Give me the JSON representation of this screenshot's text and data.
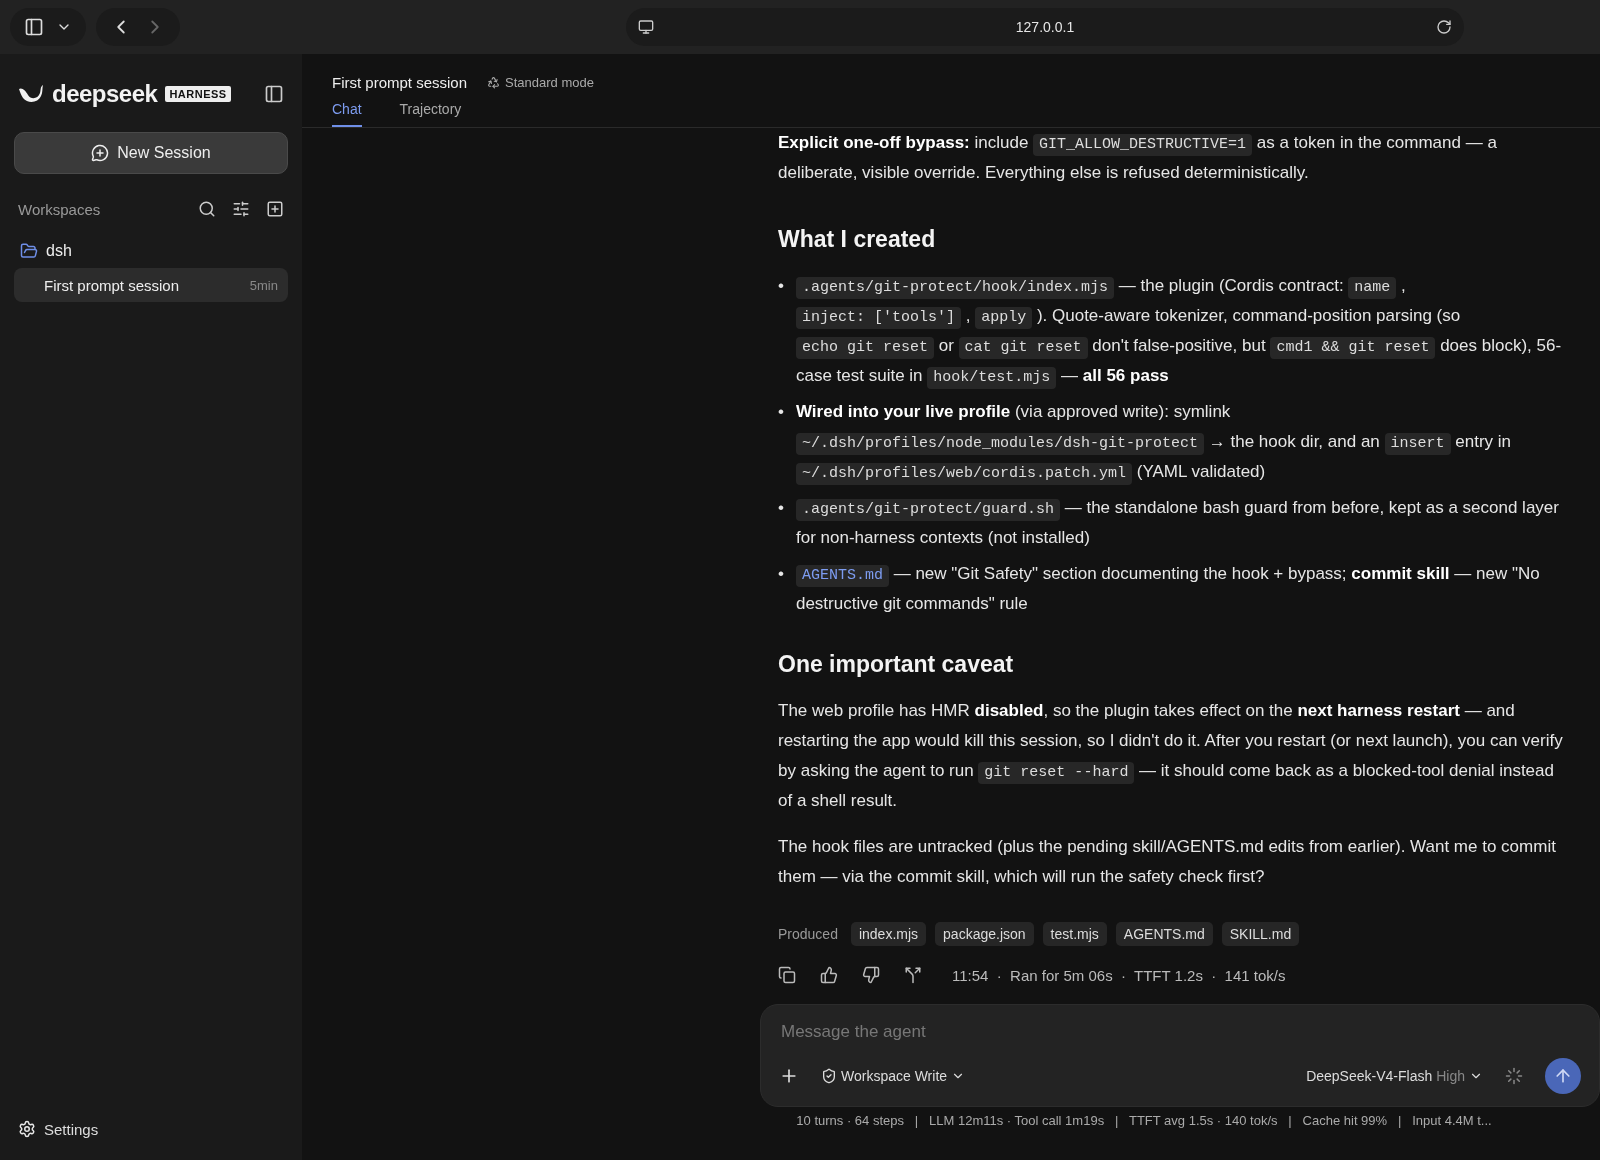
{
  "browser": {
    "url": "127.0.0.1"
  },
  "sidebar": {
    "brand": "deepseek",
    "badge": "HARNESS",
    "new_session": "New Session",
    "workspaces_label": "Workspaces",
    "workspaces": [
      {
        "name": "dsh",
        "sessions": [
          {
            "title": "First prompt session",
            "age": "5min",
            "selected": true
          }
        ]
      }
    ],
    "settings": "Settings"
  },
  "header": {
    "title": "First prompt session",
    "mode": "Standard mode",
    "tabs": [
      {
        "label": "Chat",
        "selected": true
      },
      {
        "label": "Trajectory",
        "selected": false
      }
    ]
  },
  "message": {
    "blocks": [
      {
        "kind": "paragraph",
        "segments": [
          {
            "kind": "text",
            "text": "**Explicit one-off bypass:** include "
          },
          {
            "kind": "code",
            "text": "GIT_ALLOW_DESTRUCTIVE=1"
          },
          {
            "kind": "text",
            "text": " as a token in the command — a deliberate, visible override. Everything else is refused deterministically."
          }
        ]
      },
      {
        "kind": "heading",
        "text": "What I created"
      },
      {
        "kind": "list",
        "items": [
          {
            "bullet": "•",
            "segments": [
              {
                "kind": "code",
                "text": ".agents/git-protect/hook/index.mjs"
              },
              {
                "kind": "text",
                "text": " — the plugin (Cordis contract: "
              },
              {
                "kind": "code",
                "text": "name"
              },
              {
                "kind": "text",
                "text": " , "
              },
              {
                "kind": "code",
                "text": "inject: ['tools']"
              },
              {
                "kind": "text",
                "text": " , "
              },
              {
                "kind": "code",
                "text": "apply"
              },
              {
                "kind": "text",
                "text": " ). Quote-aware tokenizer, command-position parsing (so "
              },
              {
                "kind": "code",
                "text": "echo git reset"
              },
              {
                "kind": "text",
                "text": " or "
              },
              {
                "kind": "code",
                "text": "cat git reset"
              },
              {
                "kind": "text",
                "text": " don't false-positive, but "
              },
              {
                "kind": "code",
                "text": "cmd1 && git reset"
              },
              {
                "kind": "text",
                "text": " does block), 56-case test suite in "
              },
              {
                "kind": "code",
                "text": "hook/test.mjs"
              },
              {
                "kind": "text",
                "text": " — **all 56 pass**"
              }
            ]
          },
          {
            "bullet": "•",
            "segments": [
              {
                "kind": "text",
                "text": "**Wired into your live profile** (via approved write): symlink "
              },
              {
                "kind": "code",
                "text": "~/.dsh/profiles/node_modules/dsh-git-protect"
              },
              {
                "kind": "text",
                "text": " → the hook dir, and an "
              },
              {
                "kind": "code",
                "text": "insert"
              },
              {
                "kind": "text",
                "text": " entry in "
              },
              {
                "kind": "code",
                "text": "~/.dsh/profiles/web/cordis.patch.yml"
              },
              {
                "kind": "text",
                "text": " (YAML validated)"
              }
            ]
          },
          {
            "bullet": "•",
            "segments": [
              {
                "kind": "code",
                "text": ".agents/git-protect/guard.sh"
              },
              {
                "kind": "text",
                "text": " — the standalone bash guard from before, kept as a second layer for non-harness contexts (not installed)"
              }
            ]
          },
          {
            "bullet": "•",
            "segments": [
              {
                "kind": "link",
                "text": "AGENTS.md"
              },
              {
                "kind": "text",
                "text": " — new \"Git Safety\" section documenting the hook + bypass; **commit skill** — new \"No destructive git commands\" rule"
              }
            ]
          }
        ]
      },
      {
        "kind": "heading",
        "text": "One important caveat"
      },
      {
        "kind": "paragraph",
        "segments": [
          {
            "kind": "text",
            "text": "The web profile has HMR **disabled**, so the plugin takes effect on the **next harness restart** — and restarting the app would kill this session, so I didn't do it. After you restart (or next launch), you can verify by asking the agent to run "
          },
          {
            "kind": "code",
            "text": "git reset --hard"
          },
          {
            "kind": "text",
            "text": " — it should come back as a blocked-tool denial instead of a shell result."
          }
        ]
      },
      {
        "kind": "paragraph",
        "segments": [
          {
            "kind": "text",
            "text": "The hook files are untracked (plus the pending skill/AGENTS.md edits from earlier). Want me to commit them — via the commit skill, which will run the safety check first?"
          }
        ]
      }
    ]
  },
  "produced": {
    "label": "Produced",
    "files": [
      "index.mjs",
      "package.json",
      "test.mjs",
      "AGENTS.md",
      "SKILL.md"
    ]
  },
  "meta": "11:54  ·  Ran for 5m 06s  ·  TTFT 1.2s  ·  141 tok/s",
  "composer": {
    "placeholder": "Message the agent",
    "permission": "Workspace Write",
    "model": "DeepSeek-V4-Flash",
    "effort": "High"
  },
  "stats": "10 turns · 64 steps   |   LLM 12m11s · Tool call 1m19s   |   TTFT avg 1.5s · 140 tok/s   |   Cache hit 99%   |   Input 4.4M t..."
}
